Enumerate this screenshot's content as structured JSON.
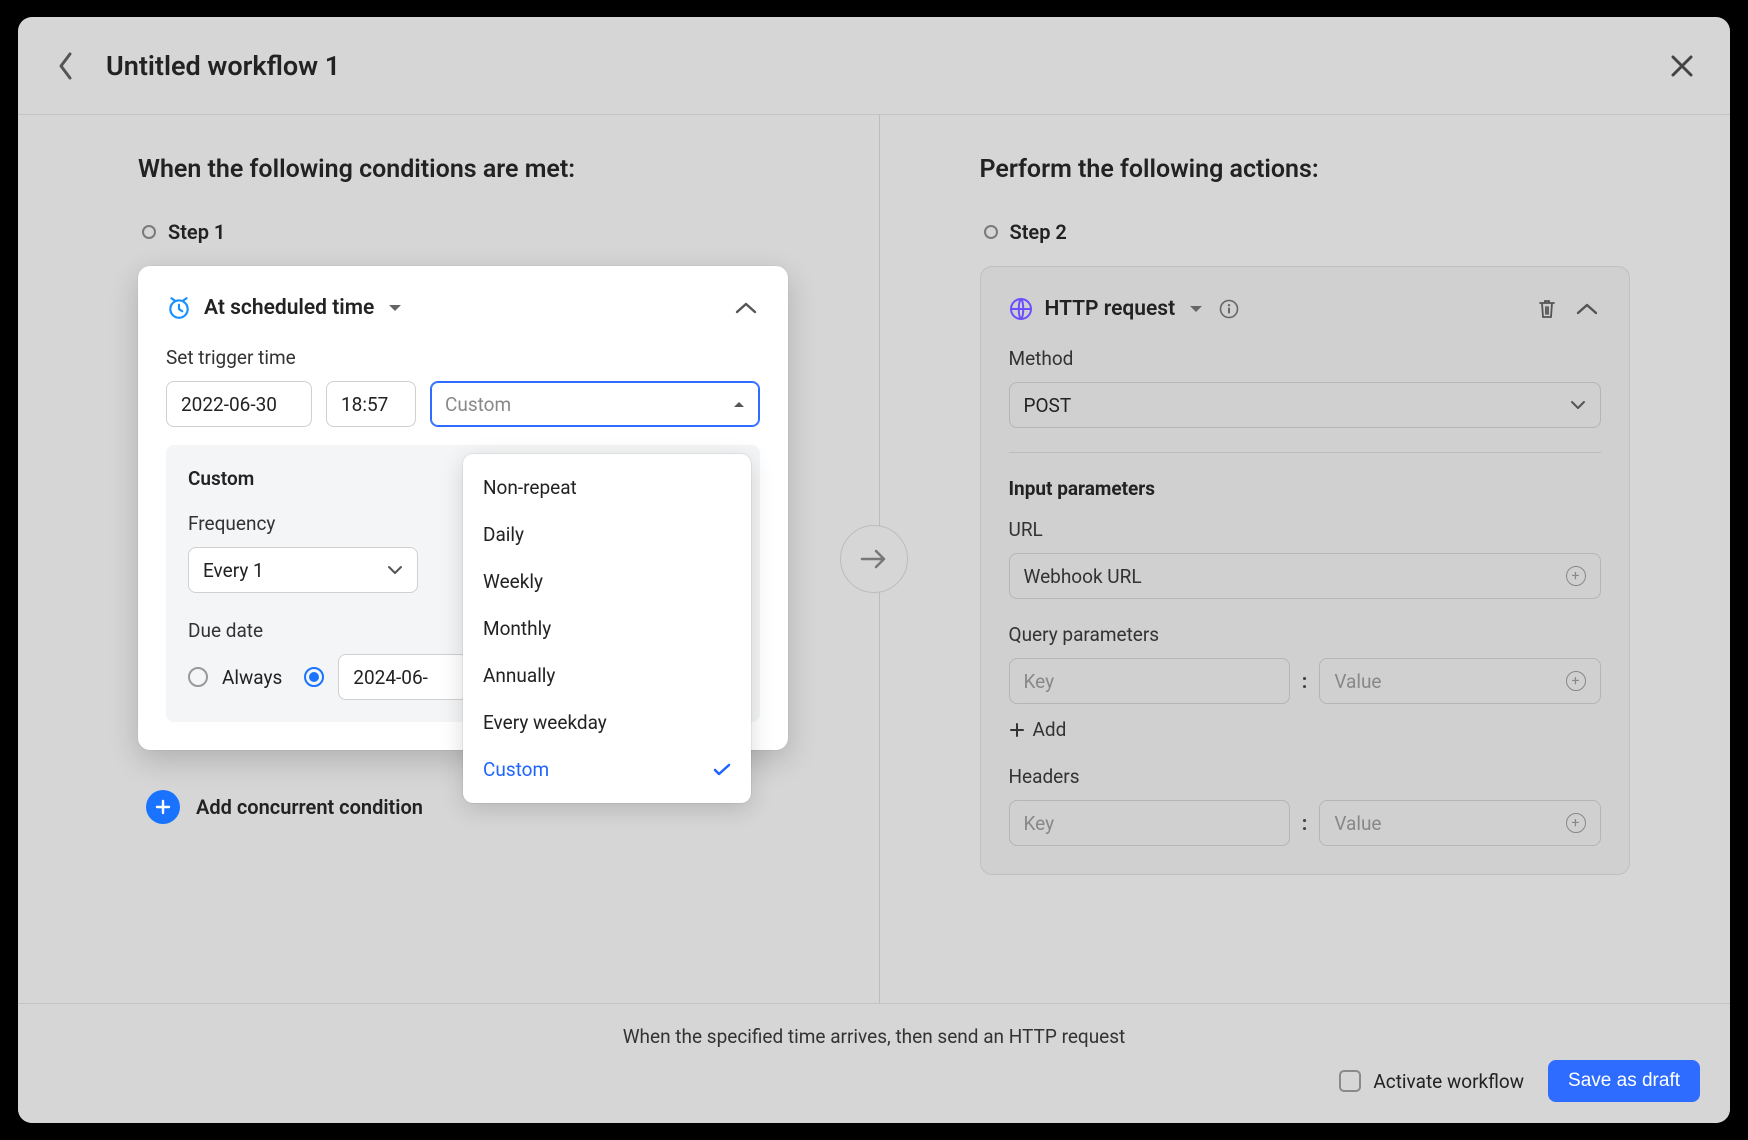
{
  "window": {
    "title": "Untitled workflow 1"
  },
  "left": {
    "heading": "When the following conditions are met:",
    "step_label": "Step 1",
    "card_title": "At scheduled time",
    "set_trigger_label": "Set trigger time",
    "date_value": "2022-06-30",
    "time_value": "18:57",
    "frequency_select_value": "Custom",
    "dropdown": {
      "options": [
        "Non-repeat",
        "Daily",
        "Weekly",
        "Monthly",
        "Annually",
        "Every weekday",
        "Custom"
      ],
      "selected": "Custom"
    },
    "custom_box": {
      "title": "Custom",
      "frequency_label": "Frequency",
      "frequency_value": "Every 1",
      "due_date_label": "Due date",
      "radio_always": "Always",
      "due_date_value": "2024-06-"
    },
    "add_concurrent": "Add concurrent condition"
  },
  "right": {
    "heading": "Perform the following actions:",
    "step_label": "Step 2",
    "card_title": "HTTP request",
    "method_label": "Method",
    "method_value": "POST",
    "input_params_label": "Input parameters",
    "url_label": "URL",
    "url_placeholder": "Webhook URL",
    "query_params_label": "Query parameters",
    "key_placeholder": "Key",
    "value_placeholder": "Value",
    "add_label": "Add",
    "headers_label": "Headers"
  },
  "footer": {
    "summary": "When the specified time arrives, then send an HTTP request",
    "activate_label": "Activate workflow",
    "save_label": "Save as draft"
  }
}
